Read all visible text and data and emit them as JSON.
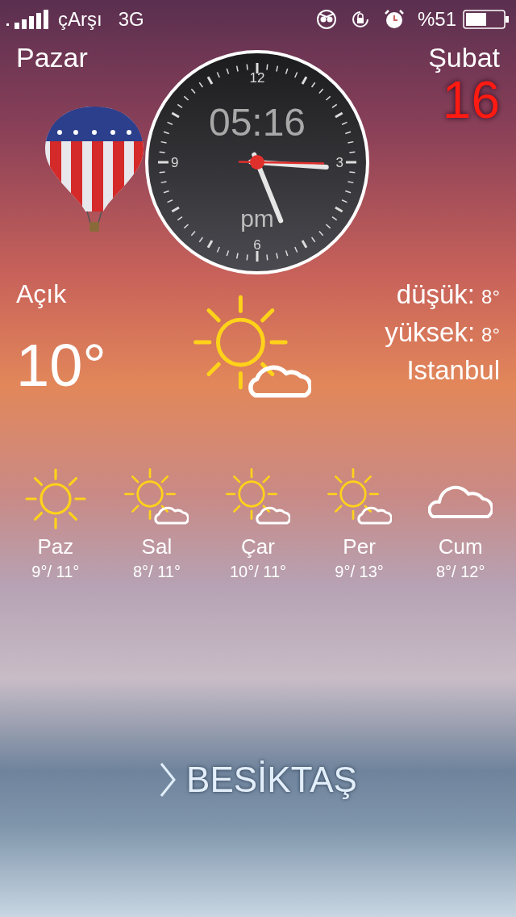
{
  "status_bar": {
    "carrier": "çArşı",
    "network": "3G",
    "battery": "%51"
  },
  "day_name": "Pazar",
  "month": "Şubat",
  "date": "16",
  "clock": {
    "digital": "05:16",
    "period": "pm",
    "numerals": [
      "12",
      "3",
      "6",
      "9"
    ]
  },
  "current": {
    "condition": "Açık",
    "temperature": "10°",
    "kind": "partly_cloudy",
    "low_label": "düşük:",
    "low": "8°",
    "high_label": "yüksek:",
    "high": "8°",
    "city": "Istanbul"
  },
  "forecast": [
    {
      "day": "Paz",
      "temps": "9°/ 11°",
      "kind": "sunny"
    },
    {
      "day": "Sal",
      "temps": "8°/ 11°",
      "kind": "partly_cloudy"
    },
    {
      "day": "Çar",
      "temps": "10°/ 11°",
      "kind": "partly_cloudy"
    },
    {
      "day": "Per",
      "temps": "9°/ 13°",
      "kind": "partly_cloudy"
    },
    {
      "day": "Cum",
      "temps": "8°/ 12°",
      "kind": "cloudy"
    }
  ],
  "unlock": {
    "label": "BESİKTAŞ"
  }
}
